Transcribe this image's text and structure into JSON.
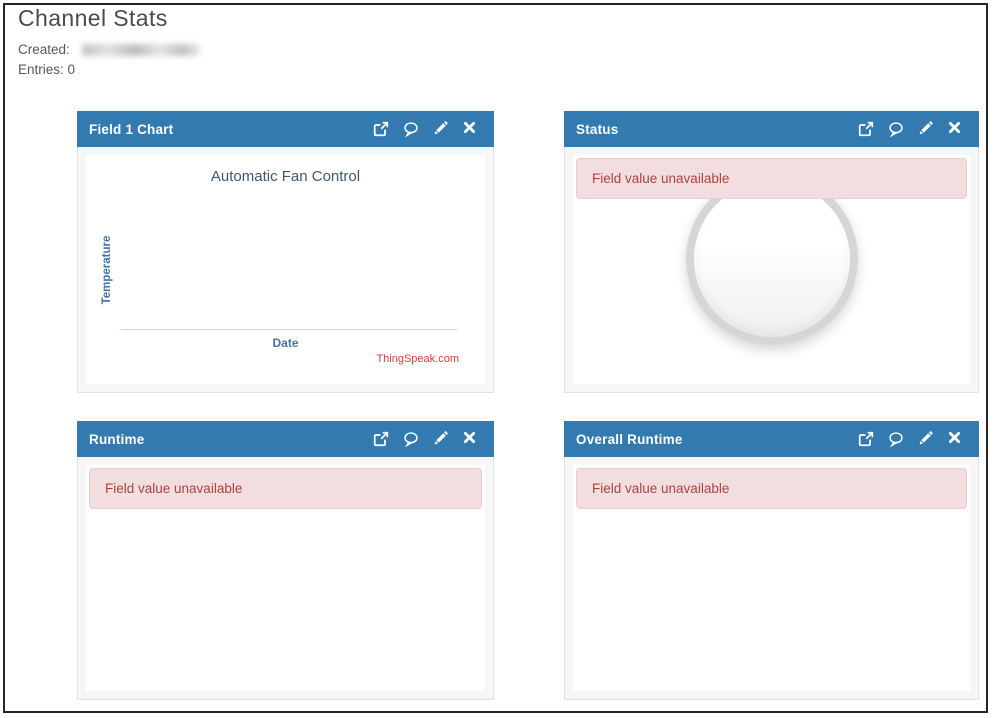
{
  "page": {
    "title": "Channel Stats",
    "created_label": "Created:",
    "created_value_redacted": true,
    "entries_line": "Entries: 0"
  },
  "colors": {
    "header_blue": "#337ab0",
    "alert_bg": "#f2dede",
    "alert_border": "#ebccd1",
    "alert_text": "#a94442",
    "chart_title_color": "#3e576f",
    "axis_label_blue": "#4572a7",
    "credit_red": "#e23a3a"
  },
  "widget_icon_names": [
    "external-link",
    "comment",
    "edit",
    "close"
  ],
  "widgets": [
    {
      "id": "field1-chart",
      "title": "Field 1 Chart",
      "type": "chart",
      "chart": {
        "type": "line",
        "title": "Automatic Fan Control",
        "ylabel": "Temperature",
        "xlabel": "Date",
        "credit": "ThingSpeak.com",
        "series": [],
        "note": "empty chart, no data points (channel has 0 entries)"
      }
    },
    {
      "id": "status",
      "title": "Status",
      "type": "indicator",
      "alert": "Field value unavailable"
    },
    {
      "id": "runtime",
      "title": "Runtime",
      "type": "value",
      "alert": "Field value unavailable"
    },
    {
      "id": "overall-runtime",
      "title": "Overall Runtime",
      "type": "value",
      "alert": "Field value unavailable"
    }
  ]
}
